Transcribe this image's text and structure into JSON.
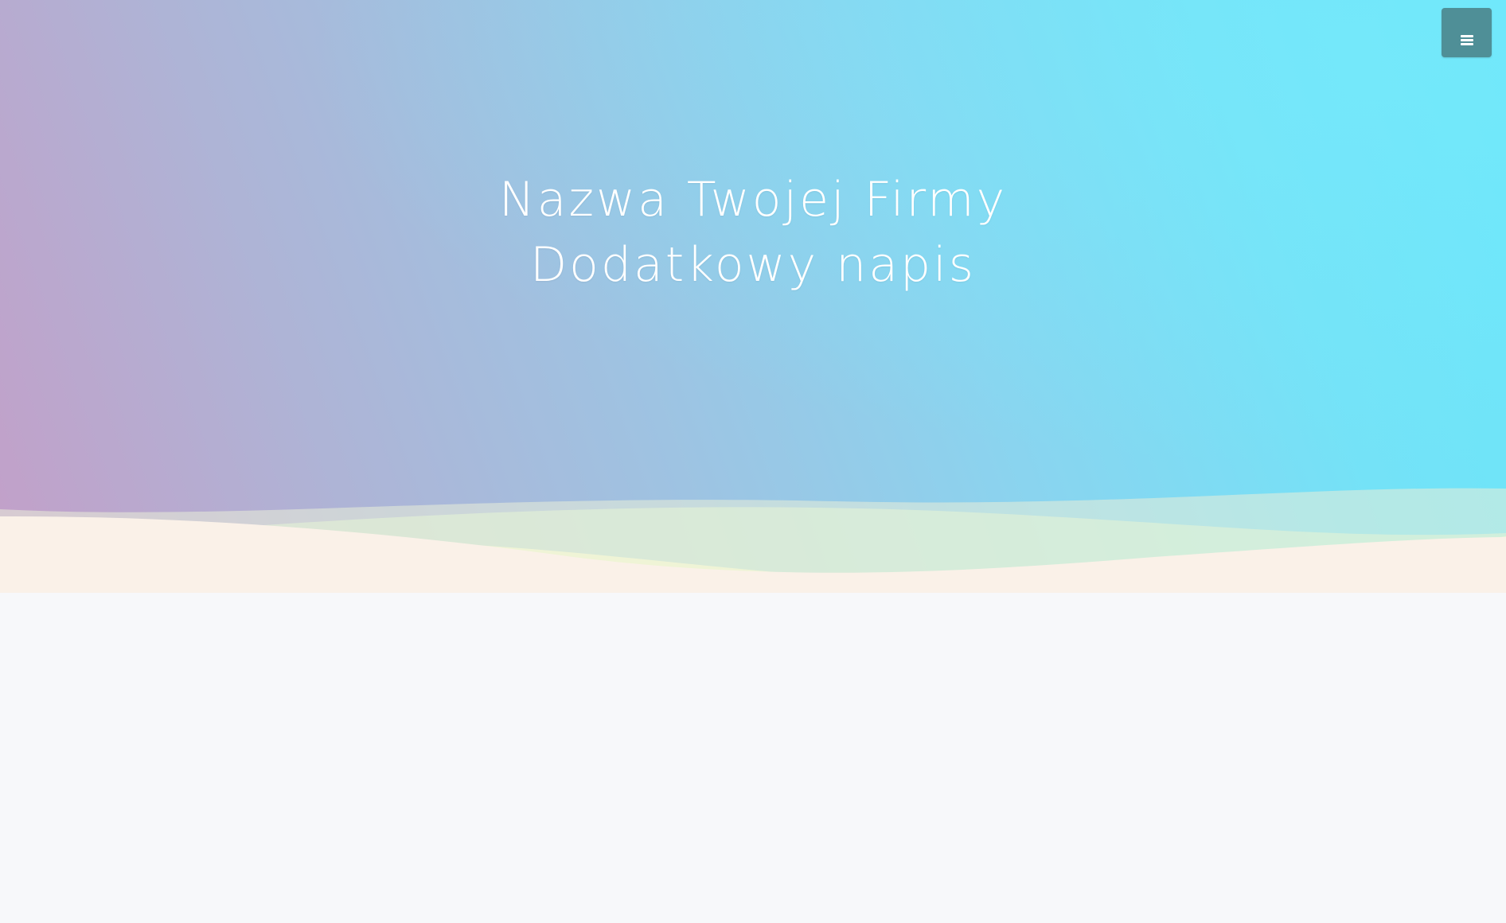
{
  "hero": {
    "title_line_1": "Nazwa Twojej Firmy",
    "title_line_2": "Dodatkowy napis"
  },
  "menu_button": {
    "icon": "hamburger-menu-icon"
  },
  "colors": {
    "gradient_left": "#c39fc8",
    "gradient_right": "#6ae6fa",
    "wave_base": "#faf1e8",
    "menu_button_bg": "#4f8f97",
    "content_bg": "#f7f8fa"
  }
}
